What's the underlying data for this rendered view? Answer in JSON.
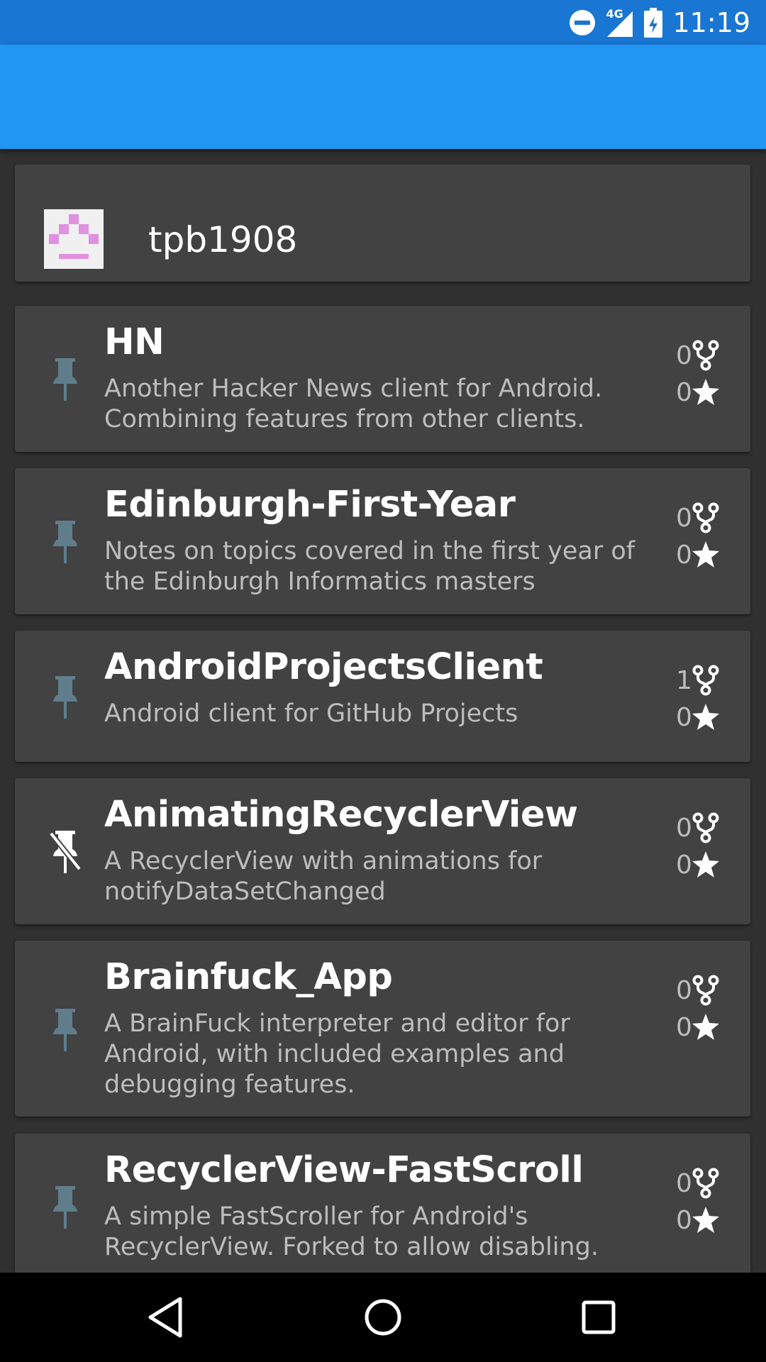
{
  "status_bar": {
    "time": "11:19",
    "network": "4G",
    "icons": [
      "do-not-disturb-icon",
      "signal-icon",
      "battery-icon"
    ]
  },
  "user": {
    "name": "tpb1908",
    "avatar_color": "#E091E0"
  },
  "repos": [
    {
      "name": "HN",
      "description": "Another Hacker News client for Android. Combining features from other clients.",
      "forks": "0",
      "stars": "0",
      "pinned": true
    },
    {
      "name": "Edinburgh-First-Year",
      "description": "Notes on topics covered in the first year of the Edinburgh Informatics masters",
      "forks": "0",
      "stars": "0",
      "pinned": true
    },
    {
      "name": "AndroidProjectsClient",
      "description": "Android client for GitHub Projects",
      "forks": "1",
      "stars": "0",
      "pinned": true
    },
    {
      "name": "AnimatingRecyclerView",
      "description": "A RecyclerView with animations for notifyDataSetChanged",
      "forks": "0",
      "stars": "0",
      "pinned": false
    },
    {
      "name": "Brainfuck_App",
      "description": "A BrainFuck interpreter and editor for Android, with included examples and debugging features.",
      "forks": "0",
      "stars": "0",
      "pinned": true
    },
    {
      "name": "RecyclerView-FastScroll",
      "description": "A simple FastScroller for Android's RecyclerView. Forked to allow disabling.",
      "forks": "0",
      "stars": "0",
      "pinned": true
    }
  ],
  "colors": {
    "status_bar": "#1976D2",
    "app_bar": "#2196F3",
    "background": "#303030",
    "card": "#424242",
    "pin": "#607D8B"
  },
  "nav": {
    "buttons": [
      "back-icon",
      "home-icon",
      "recents-icon"
    ]
  }
}
